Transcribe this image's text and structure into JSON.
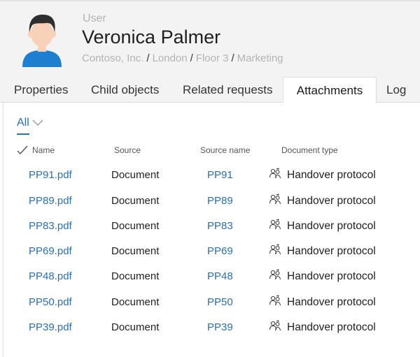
{
  "header": {
    "role": "User",
    "name": "Veronica Palmer",
    "breadcrumb": [
      "Contoso, Inc.",
      "London",
      "Floor 3",
      "Marketing"
    ],
    "breadcrumb_separator": "/"
  },
  "tabs": [
    {
      "label": "Properties",
      "active": false
    },
    {
      "label": "Child objects",
      "active": false
    },
    {
      "label": "Related requests",
      "active": false
    },
    {
      "label": "Attachments",
      "active": true
    },
    {
      "label": "Log",
      "active": false
    }
  ],
  "filter": {
    "label": "All"
  },
  "columns": {
    "name": "Name",
    "source": "Source",
    "source_name": "Source name",
    "document_type": "Document type"
  },
  "rows": [
    {
      "name": "PP91.pdf",
      "source": "Document",
      "source_name": "PP91",
      "document_type": "Handover protocol"
    },
    {
      "name": "PP89.pdf",
      "source": "Document",
      "source_name": "PP89",
      "document_type": "Handover protocol"
    },
    {
      "name": "PP83.pdf",
      "source": "Document",
      "source_name": "PP83",
      "document_type": "Handover protocol"
    },
    {
      "name": "PP69.pdf",
      "source": "Document",
      "source_name": "PP69",
      "document_type": "Handover protocol"
    },
    {
      "name": "PP48.pdf",
      "source": "Document",
      "source_name": "PP48",
      "document_type": "Handover protocol"
    },
    {
      "name": "PP50.pdf",
      "source": "Document",
      "source_name": "PP50",
      "document_type": "Handover protocol"
    },
    {
      "name": "PP39.pdf",
      "source": "Document",
      "source_name": "PP39",
      "document_type": "Handover protocol"
    }
  ],
  "colors": {
    "link": "#2b6fb6",
    "header_bg": "#f3f3f3",
    "avatar_shirt": "#1e7fd0",
    "avatar_hair": "#2f2f2f",
    "avatar_skin": "#f7d2b8"
  },
  "icons": {
    "avatar": "user-avatar-icon",
    "filter": "chevron-down-icon",
    "select_all": "checkmark-icon",
    "document_type": "people-swap-icon"
  }
}
